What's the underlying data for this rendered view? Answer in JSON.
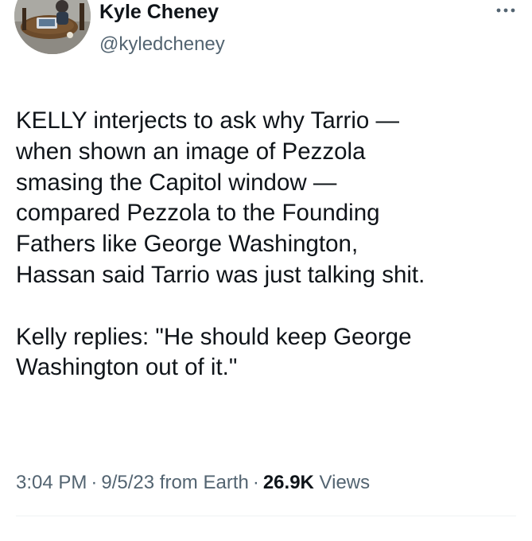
{
  "author": {
    "display_name": "Kyle Cheney",
    "handle": "@kyledcheney"
  },
  "tweet": {
    "paragraphs": [
      {
        "lines": [
          "KELLY interjects to ask why Tarrio —",
          "when shown an image of Pezzola",
          "smasing the Capitol window —",
          "compared Pezzola to the Founding",
          "Fathers like George Washington,",
          "Hassan said Tarrio was just talking shit."
        ]
      },
      {
        "lines": [
          "Kelly replies: \"He should keep George",
          "Washington out of it.\""
        ]
      }
    ]
  },
  "meta": {
    "time": "3:04 PM",
    "separator": "·",
    "date": "9/5/23",
    "source": "from Earth",
    "views_count": "26.9K",
    "views_label": "Views"
  },
  "icons": {
    "more": "more-horizontal-icon",
    "avatar": "profile-photo"
  }
}
